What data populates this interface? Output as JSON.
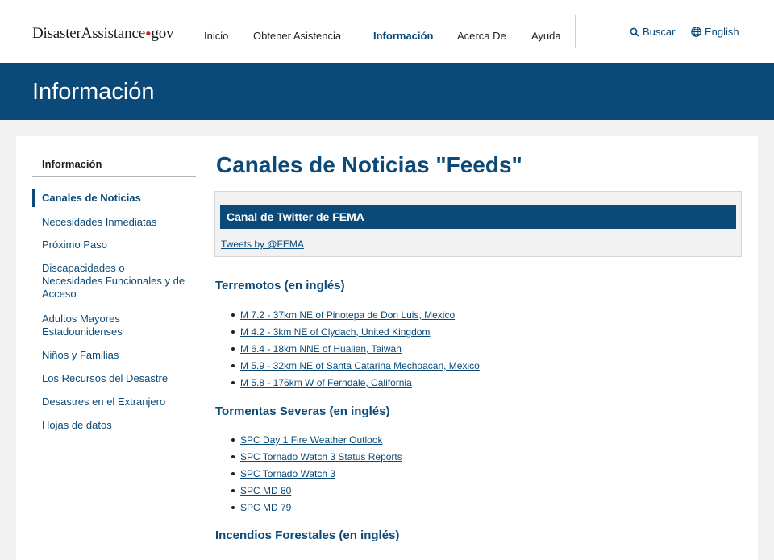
{
  "header": {
    "logo": {
      "part1": "Disaster",
      "part2": "Assistance",
      "tld": "gov"
    },
    "nav": [
      {
        "label": "Inicio"
      },
      {
        "label": "Obtener Asistencia"
      },
      {
        "label": "Información"
      },
      {
        "label": "Acerca De"
      },
      {
        "label": "Ayuda"
      }
    ],
    "search_label": "Buscar",
    "language_label": "English"
  },
  "banner": {
    "title": "Información"
  },
  "sidebar": {
    "heading": "Información",
    "items": [
      {
        "label": "Canales de Noticias"
      },
      {
        "label": "Necesidades Inmediatas"
      },
      {
        "label": "Próximo Paso"
      },
      {
        "label": "Discapacidades o Necesidades Funcionales y de Acceso"
      },
      {
        "label": "Adultos Mayores Estadounidenses"
      },
      {
        "label": "Niños y Familias"
      },
      {
        "label": "Los Recursos del Desastre"
      },
      {
        "label": "Desastres en el Extranjero"
      },
      {
        "label": "Hojas de datos"
      }
    ]
  },
  "main": {
    "title": "Canales de Noticias \"Feeds\"",
    "twitter": {
      "heading": "Canal de Twitter de FEMA",
      "link": "Tweets by @FEMA"
    },
    "sections": [
      {
        "heading": "Terremotos (en inglés)",
        "links": [
          "M 7.2 - 37km NE of Pinotepa de Don Luis, Mexico",
          "M 4.2 - 3km NE of Clydach, United Kingdom",
          "M 6.4 - 18km NNE of Hualian, Taiwan",
          "M 5.9 - 32km NE of Santa Catarina Mechoacan, Mexico",
          "M 5.8 - 176km W of Ferndale, California"
        ]
      },
      {
        "heading": "Tormentas Severas (en inglés)",
        "links": [
          "SPC Day 1 Fire Weather Outlook",
          "SPC Tornado Watch 3 Status Reports",
          "SPC Tornado Watch 3",
          "SPC MD 80",
          "SPC MD 79"
        ]
      },
      {
        "heading": "Incendios Forestales (en inglés)",
        "links": []
      }
    ]
  },
  "colors": {
    "brand_blue": "#0b4a78",
    "logo_dot": "#cd2026",
    "page_bg": "#f1f1f1"
  }
}
